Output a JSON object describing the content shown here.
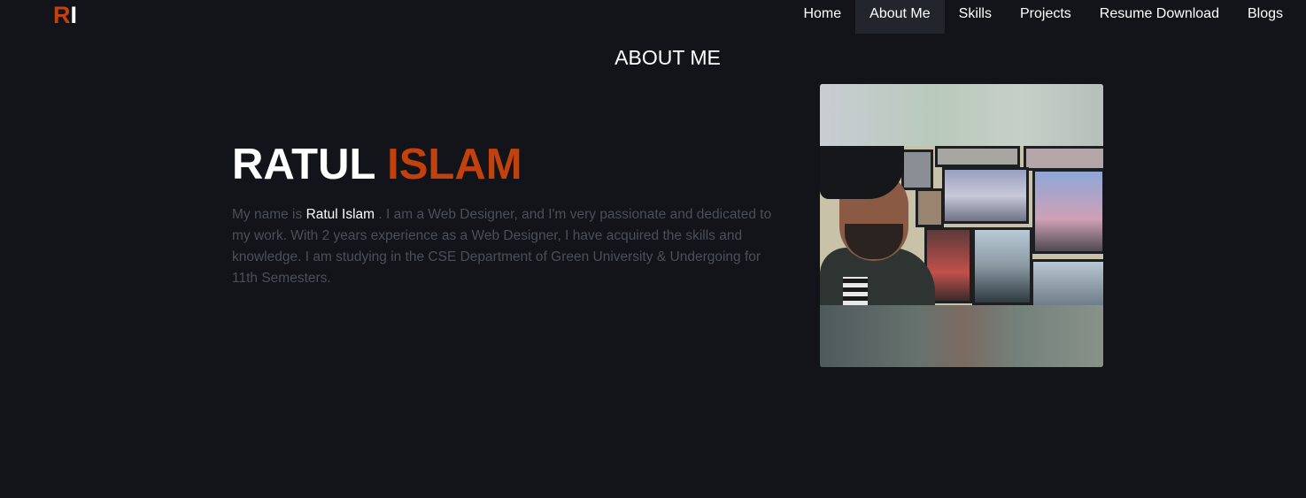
{
  "logo": {
    "first": "R",
    "second": "I"
  },
  "nav": {
    "items": [
      {
        "label": "Home"
      },
      {
        "label": "About Me"
      },
      {
        "label": "Skills"
      },
      {
        "label": "Projects"
      },
      {
        "label": "Resume Download"
      },
      {
        "label": "Blogs"
      }
    ],
    "active": "About Me"
  },
  "section": {
    "title": "ABOUT ME"
  },
  "profile": {
    "first_name": "RATUL",
    "last_name": "ISLAM",
    "bio_prefix": "My name is ",
    "bio_name": "Ratul Islam",
    "bio_suffix": " . I am a Web Designer, and I'm very passionate and dedicated to my work. With 2 years experience as a Web Designer, I have acquired the skills and knowledge. I am studying in the CSE Department of Green University & Undergoing for 11th Semesters."
  },
  "colors": {
    "background": "#12141a",
    "accent": "#c2410c",
    "muted_text": "#4b4f58",
    "active_nav": "#22252c"
  }
}
